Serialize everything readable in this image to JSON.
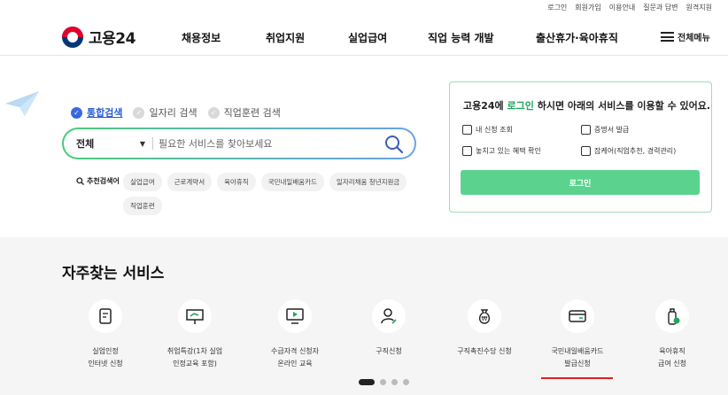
{
  "utility_links": [
    "로그인",
    "회원가입",
    "이용안내",
    "질문과 답변",
    "원격지원"
  ],
  "logo_text": "고용24",
  "nav": [
    "채용정보",
    "취업지원",
    "실업급여",
    "직업 능력 개발",
    "출산휴가·육아휴직"
  ],
  "all_menu_label": "전체메뉴",
  "search_tabs": [
    {
      "label": "통합검색",
      "active": true
    },
    {
      "label": "일자리 검색",
      "active": false
    },
    {
      "label": "직업훈련 검색",
      "active": false
    }
  ],
  "search": {
    "scope": "전체",
    "placeholder": "필요한 서비스를 찾아보세요"
  },
  "recommend": {
    "label": "추천검색어",
    "chips": [
      "실업급여",
      "근로계약서",
      "육아휴직",
      "국민내일배움카드",
      "일자리채움 청년지원금",
      "직업훈련"
    ]
  },
  "login_box": {
    "title_pre": "고용24에 ",
    "title_link": "로그인",
    "title_post": " 하시면 아래의 서비스를 이용할 수 있어요.",
    "items": [
      "내 신청 조회",
      "증명서 발급",
      "놓치고 있는 혜택 확인",
      "잡케어(직업추천, 경력관리)"
    ],
    "button": "로그인"
  },
  "services": {
    "title": "자주찾는 서비스",
    "items": [
      {
        "label": "실업인정\n인터넷 신청",
        "icon": "document-icon"
      },
      {
        "label": "취업특강(1차 실업\n인정교육 포함)",
        "icon": "presentation-icon"
      },
      {
        "label": "수급자격 신청자\n온라인 교육",
        "icon": "monitor-play-icon"
      },
      {
        "label": "구직신청",
        "icon": "person-edit-icon"
      },
      {
        "label": "구직촉진수당 신청",
        "icon": "money-bag-icon"
      },
      {
        "label": "국민내일배움카드\n발급신청",
        "icon": "card-icon"
      },
      {
        "label": "육아휴직\n급여 신청",
        "icon": "baby-bottle-icon"
      }
    ]
  },
  "pagination": {
    "total": 4,
    "current": 1
  }
}
